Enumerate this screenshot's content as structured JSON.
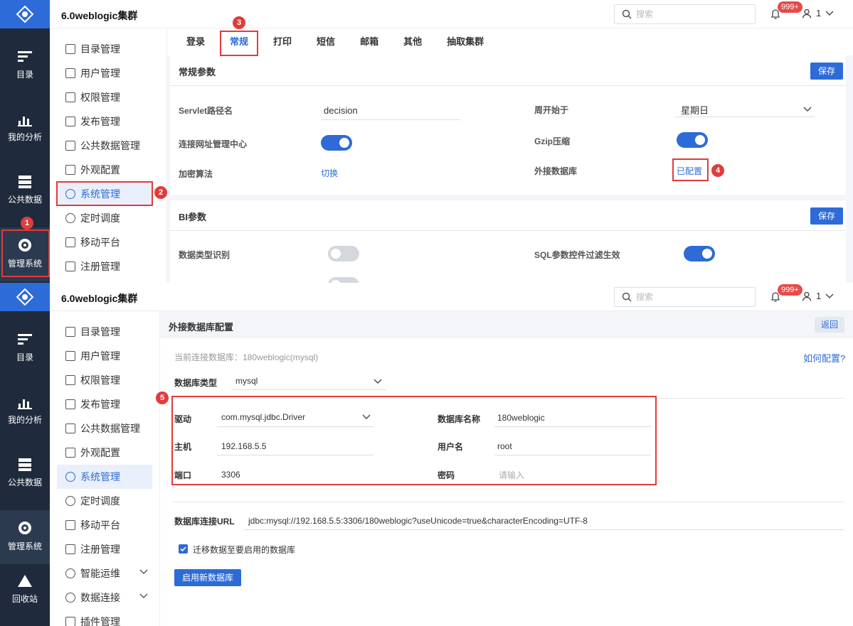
{
  "app": {
    "cluster_title": "6.0weblogic集群",
    "search_placeholder": "搜索",
    "badge": "999+",
    "user": "1"
  },
  "rail": {
    "items": [
      {
        "label": "目录",
        "icon": "catalog-icon"
      },
      {
        "label": "我的分析",
        "icon": "analysis-icon"
      },
      {
        "label": "公共数据",
        "icon": "database-icon"
      },
      {
        "label": "管理系统",
        "icon": "gear-icon"
      },
      {
        "label": "回收站",
        "icon": "recycle-icon"
      }
    ]
  },
  "sidebar": {
    "items": [
      {
        "label": "目录管理"
      },
      {
        "label": "用户管理"
      },
      {
        "label": "权限管理"
      },
      {
        "label": "发布管理"
      },
      {
        "label": "公共数据管理"
      },
      {
        "label": "外观配置"
      },
      {
        "label": "系统管理"
      },
      {
        "label": "定时调度"
      },
      {
        "label": "移动平台"
      },
      {
        "label": "注册管理"
      },
      {
        "label": "智能运维"
      },
      {
        "label": "数据连接"
      },
      {
        "label": "插件管理"
      }
    ]
  },
  "panel1": {
    "tabs": [
      "登录",
      "常规",
      "打印",
      "短信",
      "邮箱",
      "其他",
      "抽取集群"
    ],
    "general": {
      "title": "常规参数",
      "save": "保存",
      "servlet_label": "Servlet路径名",
      "servlet_value": "decision",
      "week_label": "周开始于",
      "week_value": "星期日",
      "conn_label": "连接网址管理中心",
      "gzip_label": "Gzip压缩",
      "encrypt_label": "加密算法",
      "encrypt_link": "切换",
      "extdb_label": "外接数据库",
      "extdb_link": "已配置"
    },
    "bi": {
      "title": "BI参数",
      "save": "保存",
      "type_label": "数据类型识别",
      "sql_label": "SQL参数控件过滤生效"
    },
    "markers": [
      "1",
      "2",
      "3",
      "4"
    ]
  },
  "panel2": {
    "title": "外接数据库配置",
    "back": "返回",
    "current": "当前连接数据库：180weblogic(mysql)",
    "how": "如何配置?",
    "dbtype_label": "数据库类型",
    "dbtype_value": "mysql",
    "driver_label": "驱动",
    "driver_value": "com.mysql.jdbc.Driver",
    "dbname_label": "数据库名称",
    "dbname_value": "180weblogic",
    "host_label": "主机",
    "host_value": "192.168.5.5",
    "user_label": "用户名",
    "user_value": "root",
    "port_label": "端口",
    "port_value": "3306",
    "pwd_label": "密码",
    "pwd_placeholder": "请输入",
    "url_label": "数据库连接URL",
    "url_value": "jdbc:mysql://192.168.5.5:3306/180weblogic?useUnicode=true&characterEncoding=UTF-8",
    "migrate_label": "迁移数据至要启用的数据库",
    "enable_btn": "启用新数据库",
    "marker": "5"
  }
}
